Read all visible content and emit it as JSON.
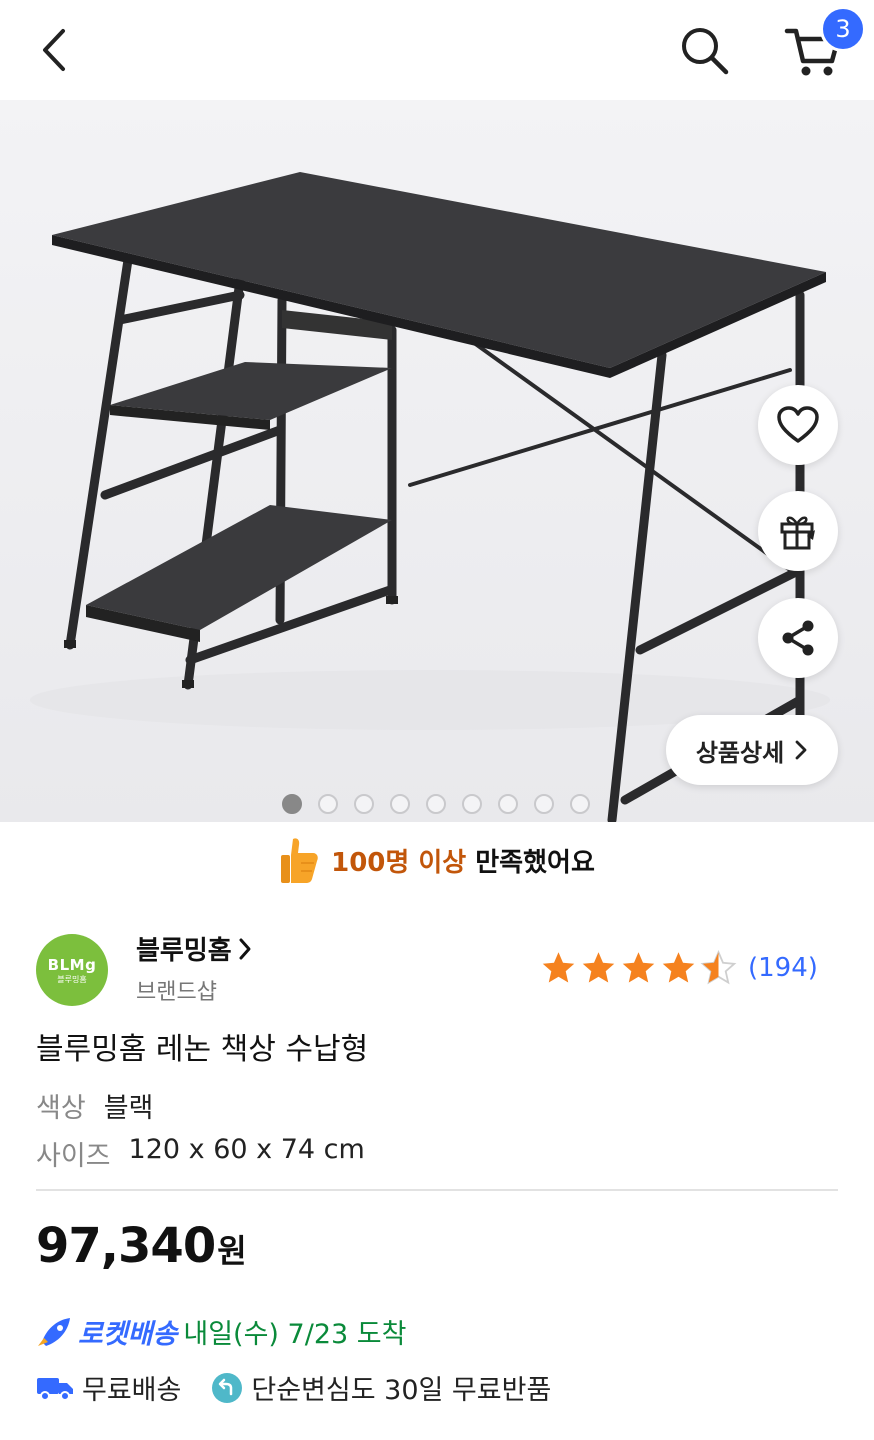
{
  "header": {
    "back_icon": "chevron-left-icon",
    "search_icon": "search-icon",
    "cart_icon": "cart-icon",
    "cart_count": "3"
  },
  "hero": {
    "side_buttons": [
      "heart-icon",
      "gift-icon",
      "share-icon"
    ],
    "detail_label": "상품상세",
    "carousel": {
      "total": 9,
      "active_index": 0
    }
  },
  "satisfaction": {
    "highlight": "100명 이상",
    "rest": "만족했어요"
  },
  "brand": {
    "logo_text": "BLMg",
    "logo_sub": "블루밍홈",
    "name": "블루밍홈",
    "shop_label": "브랜드샵"
  },
  "rating": {
    "stars": 4.5,
    "count": "(194)",
    "star_color": "#f5821f"
  },
  "product": {
    "title": "블루밍홈 레논 책상 수납형",
    "options": [
      {
        "key": "색상",
        "value": "블랙"
      },
      {
        "key": "사이즈",
        "value": "120 x 60 x 74 cm"
      }
    ],
    "price": "97,340",
    "price_unit": "원"
  },
  "delivery": {
    "rocket_label": "로켓배송",
    "eta": "내일(수) 7/23 도착",
    "free_shipping": "무료배송",
    "return_policy": "단순변심도 30일 무료반품"
  },
  "colors": {
    "accent": "#346aff",
    "eta_green": "#0a8a3a",
    "satisfy_orange": "#c2560a",
    "brand_green": "#7cbf3d"
  }
}
